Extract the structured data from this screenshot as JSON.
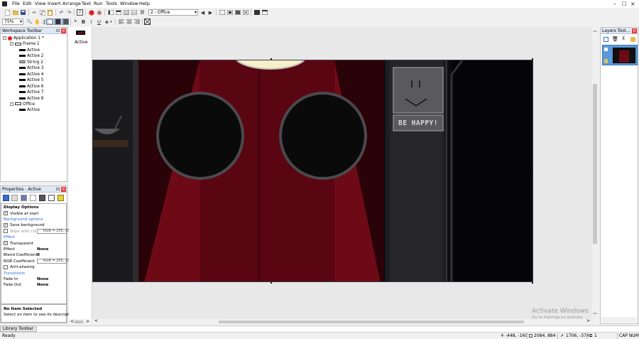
{
  "menubar": {
    "items": [
      "File",
      "Edit",
      "View",
      "Insert",
      "Arrange",
      "Text",
      "Run",
      "Tools",
      "Window",
      "Help"
    ],
    "window_controls": [
      "–",
      "□",
      "×"
    ]
  },
  "toolbar": {
    "frame_combo": "2 - Office",
    "zoom_combo": "75%"
  },
  "workspace": {
    "title": "Workspace Toolbar",
    "tree": [
      {
        "label": "Application 1 *",
        "level": 0,
        "icon": "app-icon"
      },
      {
        "label": "Frame 1",
        "level": 1,
        "icon": "frame-icon"
      },
      {
        "label": "Active",
        "level": 2,
        "icon": "active-object-icon"
      },
      {
        "label": "Active 2",
        "level": 2,
        "icon": "active-object-icon"
      },
      {
        "label": "String 2",
        "level": 2,
        "icon": "string-object-icon"
      },
      {
        "label": "Active 3",
        "level": 2,
        "icon": "active-object-icon"
      },
      {
        "label": "Active 4",
        "level": 2,
        "icon": "active-object-icon"
      },
      {
        "label": "Active 5",
        "level": 2,
        "icon": "active-object-icon"
      },
      {
        "label": "Active 6",
        "level": 2,
        "icon": "active-object-icon"
      },
      {
        "label": "Active 7",
        "level": 2,
        "icon": "active-object-icon"
      },
      {
        "label": "Active 8",
        "level": 2,
        "icon": "active-object-icon"
      },
      {
        "label": "Office",
        "level": 1,
        "icon": "frame-icon"
      },
      {
        "label": "Active",
        "level": 2,
        "icon": "active-object-icon"
      }
    ]
  },
  "properties": {
    "title": "Properties - Active",
    "heading": "Display Options",
    "rows": [
      {
        "type": "check",
        "label": "Visible at start",
        "checked": true
      },
      {
        "type": "section",
        "label": "Background options"
      },
      {
        "type": "check",
        "label": "Save background",
        "checked": true
      },
      {
        "type": "checkrgb",
        "label": "Wipe with col",
        "checked": false,
        "value": "RGB = 255, 25"
      },
      {
        "type": "section",
        "label": "Effect"
      },
      {
        "type": "check",
        "label": "Transparent",
        "checked": true
      },
      {
        "type": "value",
        "label": "Effect",
        "value": "None"
      },
      {
        "type": "value",
        "label": "Blend Coefficient",
        "value": "0"
      },
      {
        "type": "rgb",
        "label": "RGB Coefficient",
        "value": "RGB = 255, 25"
      },
      {
        "type": "check",
        "label": "Anti-aliasing",
        "checked": false
      },
      {
        "type": "section",
        "label": "Transitions"
      },
      {
        "type": "value",
        "label": "Fade In",
        "value": "None"
      },
      {
        "type": "value",
        "label": "Fade Out",
        "value": "None"
      }
    ],
    "desc_title": "No Item Selected",
    "desc_text": "Select an item to see its description"
  },
  "object_shelf": {
    "label": "Active"
  },
  "canvas": {
    "sign_text": "BE HAPPY!",
    "colors": {
      "background": "#0b0b0d",
      "carpet": "#6e0a16",
      "curtain": "#4a0410"
    }
  },
  "layers": {
    "title": "Layers Tool..."
  },
  "library": {
    "tab": "Library Toolbar"
  },
  "watermark": {
    "title": "Activate Windows",
    "subtitle": "Go to Settings to activate Windows."
  },
  "statusbar": {
    "ready": "Ready",
    "coords": "-448, -160",
    "size": "2084, 884",
    "cursor": "1706, -374",
    "layer": "1",
    "keys": "CAP  NUM"
  }
}
